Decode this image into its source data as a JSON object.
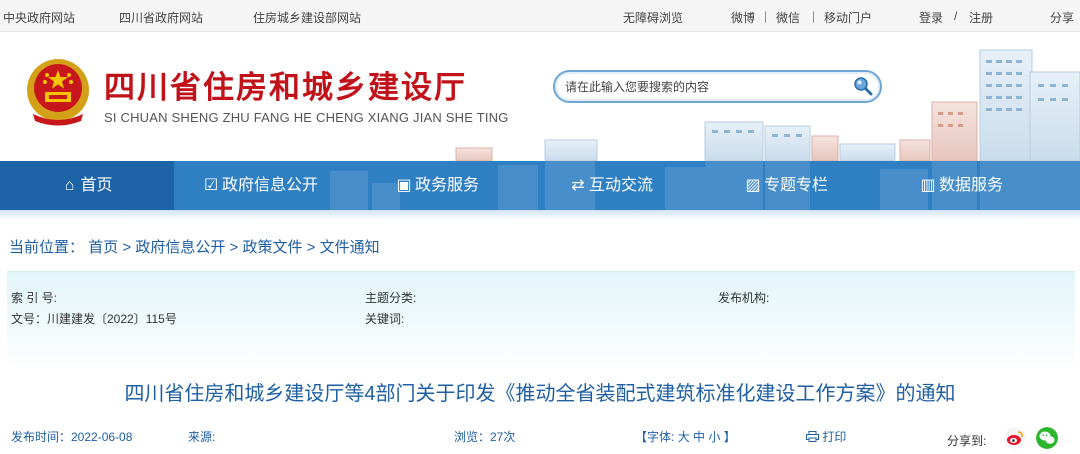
{
  "topbar": {
    "links": [
      "中央政府网站",
      "四川省政府网站",
      "住房城乡建设部网站"
    ],
    "accessibility": "无障碍浏览",
    "weibo": "微博",
    "wechat": "微信",
    "mobile": "移动门户",
    "login": "登录",
    "slash": "/",
    "register": "注册",
    "share": "分享",
    "divider": "|"
  },
  "header": {
    "title": "四川省住房和城乡建设厅",
    "subtitle": "SI CHUAN SHENG ZHU FANG HE CHENG XIANG JIAN SHE TING",
    "search_placeholder": "请在此输入您要搜索的内容"
  },
  "nav": [
    {
      "label": "首页",
      "icon": "home-icon",
      "glyph": "⌂"
    },
    {
      "label": "政府信息公开",
      "icon": "edit-icon",
      "glyph": "☑"
    },
    {
      "label": "政务服务",
      "icon": "monitor-icon",
      "glyph": "▣"
    },
    {
      "label": "互动交流",
      "icon": "exchange-icon",
      "glyph": "⇄"
    },
    {
      "label": "专题专栏",
      "icon": "picture-icon",
      "glyph": "▨"
    },
    {
      "label": "数据服务",
      "icon": "chart-icon",
      "glyph": "▥"
    }
  ],
  "breadcrumb": {
    "label": "当前位置：",
    "items": [
      "首页",
      "政府信息公开",
      "政策文件",
      "文件通知"
    ],
    "sep": ">"
  },
  "info": {
    "index_label": "索 引 号:",
    "topic_label": "主题分类:",
    "publisher_label": "发布机构:",
    "docno": "文号：川建建发〔2022〕115号",
    "keywords_label": "关键词:"
  },
  "document": {
    "title": "四川省住房和城乡建设厅等4部门关于印发《推动全省装配式建筑标准化建设工作方案》的通知"
  },
  "meta": {
    "date": "发布时间：2022-06-08",
    "source": "来源:",
    "views": "浏览：27次",
    "font_open": "【字体:",
    "font_large": "大",
    "font_medium": "中",
    "font_small": "小",
    "font_close": "】",
    "print": "打印",
    "share_to": "分享到:"
  },
  "colors": {
    "brand_red": "#c1121a",
    "nav_blue": "#2f7fc3",
    "link_blue": "#1f5fa3"
  }
}
